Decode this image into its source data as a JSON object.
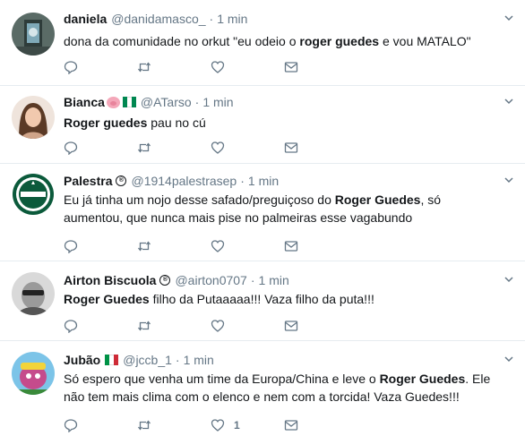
{
  "tweets": [
    {
      "name": "daniela",
      "handle": "@danidamasco_",
      "time": "1 min",
      "text_parts": [
        "dona da comunidade no orkut \"eu odeio o ",
        "roger guedes",
        " e vou MATALO\""
      ],
      "like_count": ""
    },
    {
      "name": "Bianca",
      "handle": "@ATarso",
      "time": "1 min",
      "text_parts": [
        "",
        "Roger guedes",
        " pau no cú"
      ],
      "like_count": ""
    },
    {
      "name": "Palestra",
      "handle": "@1914palestrasep",
      "time": "1 min",
      "text_parts": [
        "Eu já tinha um nojo desse safado/preguiçoso do ",
        "Roger Guedes",
        ", só aumentou, que nunca mais pise no palmeiras esse vagabundo"
      ],
      "like_count": ""
    },
    {
      "name": "Airton Biscuola",
      "handle": "@airton0707",
      "time": "1 min",
      "text_parts": [
        "",
        "Roger Guedes",
        " filho da Putaaaaa!!! Vaza filho da puta!!!"
      ],
      "like_count": ""
    },
    {
      "name": "Jubão",
      "handle": "@jccb_1",
      "time": "1 min",
      "text_parts": [
        "Só espero que venha um time da Europa/China e leve o ",
        "Roger Guedes",
        ". Ele não tem mais clima com o elenco e nem com a torcida! Vaza Guedes!!!"
      ],
      "like_count": "1"
    }
  ],
  "separator": "·",
  "verified_glyph": "®",
  "icons": [
    "reply-icon",
    "retweet-icon",
    "like-icon",
    "message-icon",
    "chevron-down-icon"
  ],
  "colors": {
    "text": "#14171a",
    "secondary": "#657786",
    "divider": "#e6ecf0",
    "nigeria_green": "#008751",
    "italy_green": "#009246",
    "italy_red": "#ce2b37"
  }
}
